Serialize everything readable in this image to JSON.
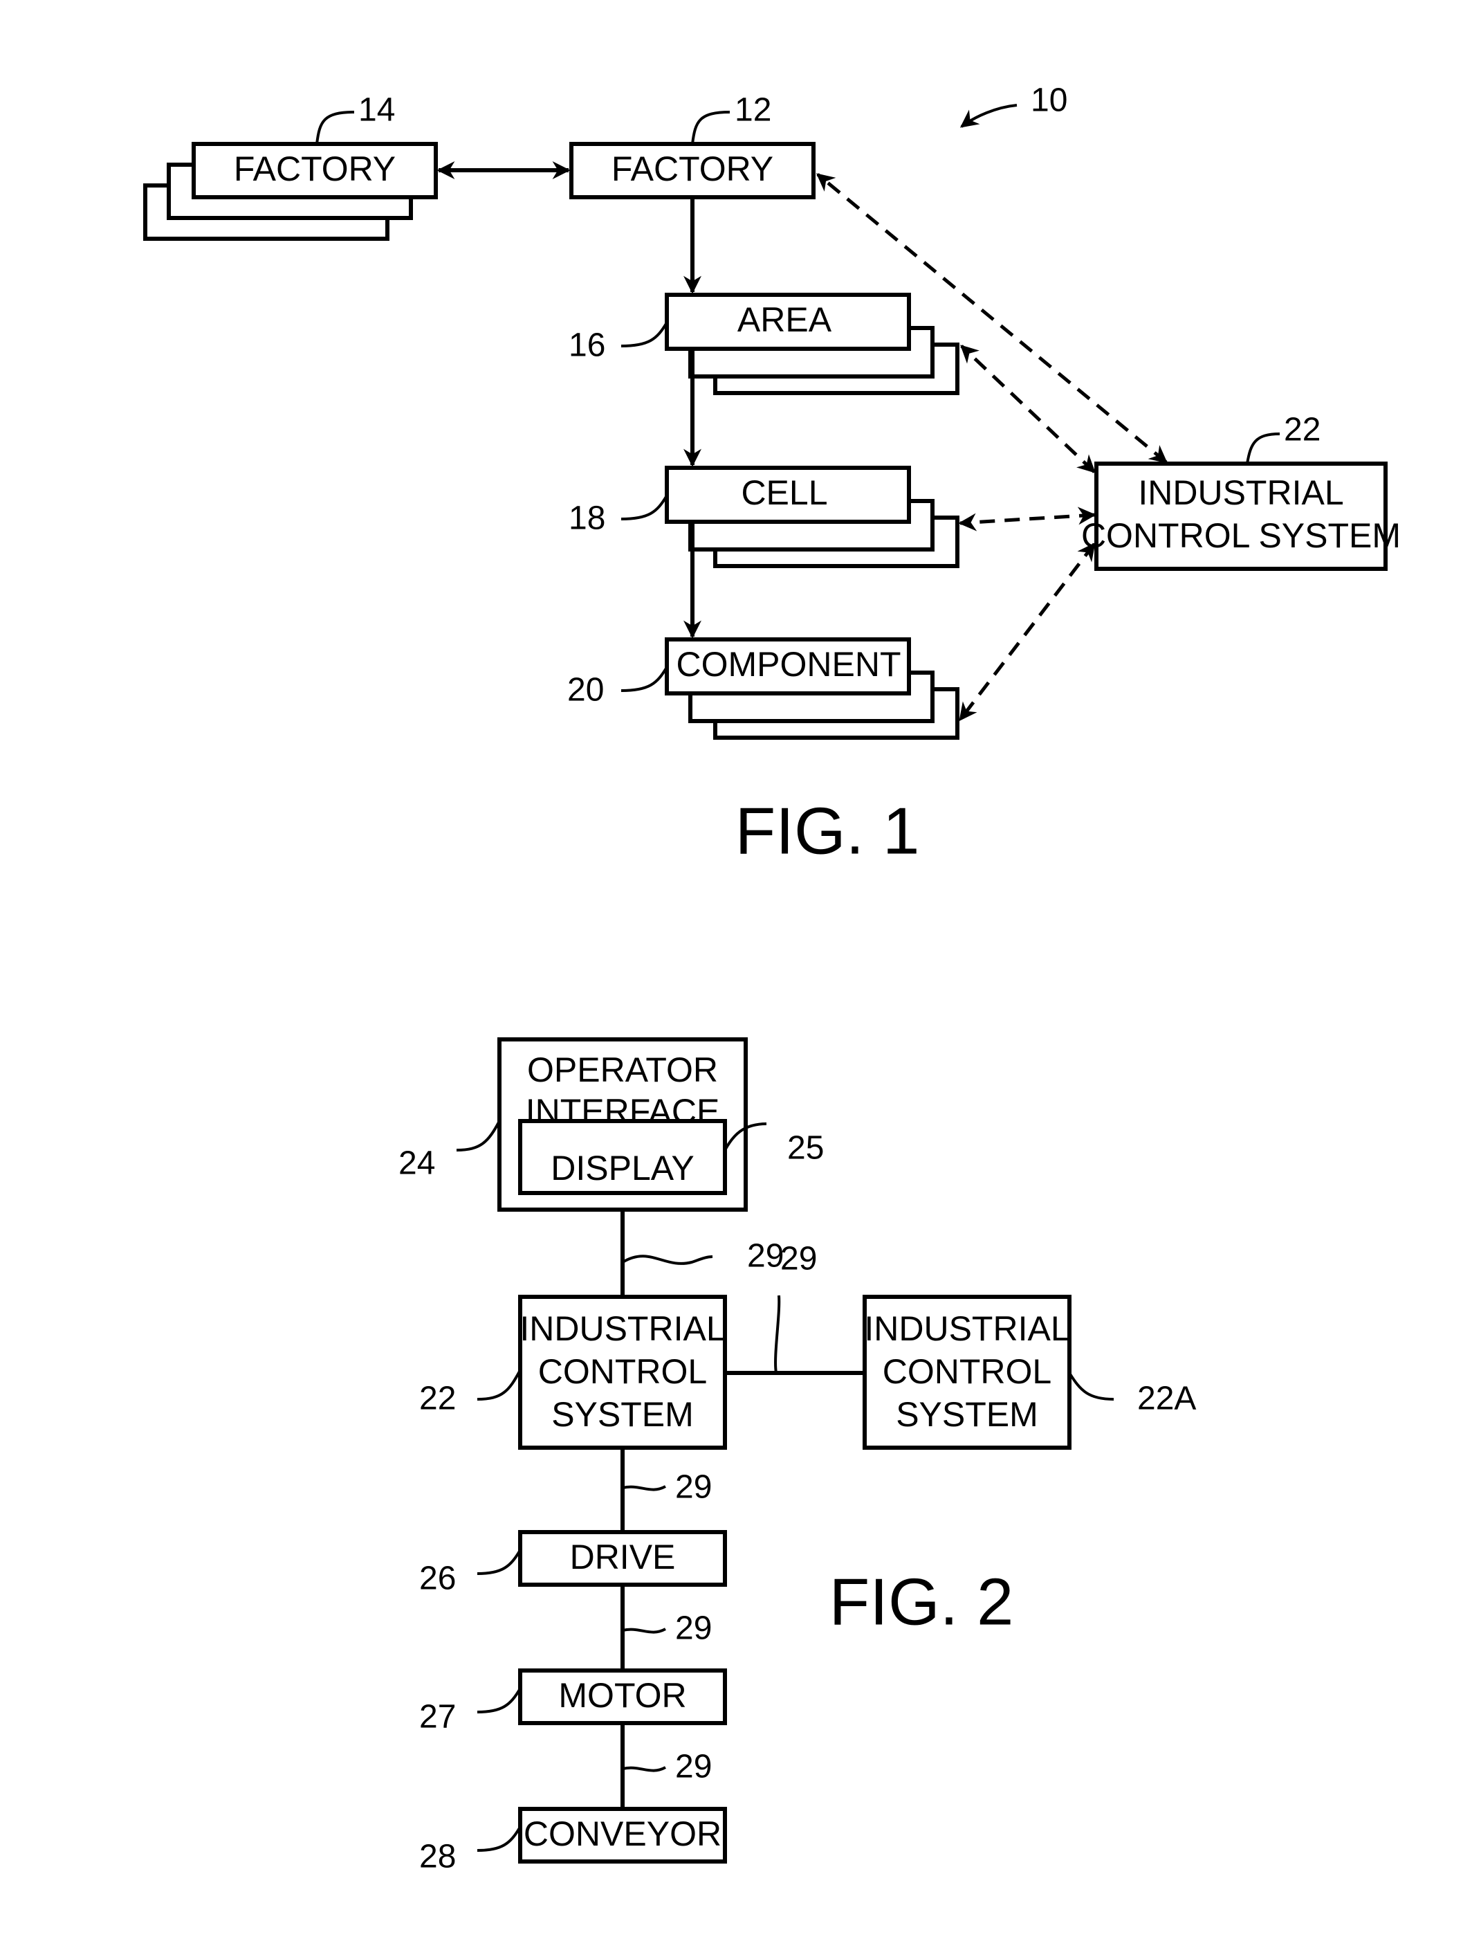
{
  "fig1": {
    "caption": "FIG. 1",
    "ref_system": "10",
    "nodes": {
      "factory_remote": {
        "label": "FACTORY",
        "ref": "14"
      },
      "factory": {
        "label": "FACTORY",
        "ref": "12"
      },
      "area": {
        "label": "AREA",
        "ref": "16"
      },
      "cell": {
        "label": "CELL",
        "ref": "18"
      },
      "component": {
        "label": "COMPONENT",
        "ref": "20"
      },
      "ics": {
        "label_line1": "INDUSTRIAL",
        "label_line2": "CONTROL SYSTEM",
        "ref": "22"
      }
    },
    "edges": [
      {
        "from": "factory_remote",
        "to": "factory",
        "style": "solid",
        "direction": "both"
      },
      {
        "from": "factory",
        "to": "area",
        "style": "solid",
        "direction": "forward"
      },
      {
        "from": "area",
        "to": "cell",
        "style": "solid",
        "direction": "forward"
      },
      {
        "from": "cell",
        "to": "component",
        "style": "solid",
        "direction": "forward"
      },
      {
        "from": "ics",
        "to": "factory",
        "style": "dashed",
        "direction": "both"
      },
      {
        "from": "ics",
        "to": "area",
        "style": "dashed",
        "direction": "both"
      },
      {
        "from": "ics",
        "to": "cell",
        "style": "dashed",
        "direction": "both"
      },
      {
        "from": "ics",
        "to": "component",
        "style": "dashed",
        "direction": "both"
      }
    ]
  },
  "fig2": {
    "caption": "FIG. 2",
    "nodes": {
      "operator_interface": {
        "label_line1": "OPERATOR",
        "label_line2": "INTERFACE",
        "ref": "24"
      },
      "display": {
        "label": "DISPLAY",
        "ref": "25"
      },
      "ics": {
        "label_line1": "INDUSTRIAL",
        "label_line2": "CONTROL",
        "label_line3": "SYSTEM",
        "ref": "22"
      },
      "ics_a": {
        "label_line1": "INDUSTRIAL",
        "label_line2": "CONTROL",
        "label_line3": "SYSTEM",
        "ref": "22A"
      },
      "drive": {
        "label": "DRIVE",
        "ref": "26"
      },
      "motor": {
        "label": "MOTOR",
        "ref": "27"
      },
      "conveyor": {
        "label": "CONVEYOR",
        "ref": "28"
      }
    },
    "link_ref": "29"
  }
}
